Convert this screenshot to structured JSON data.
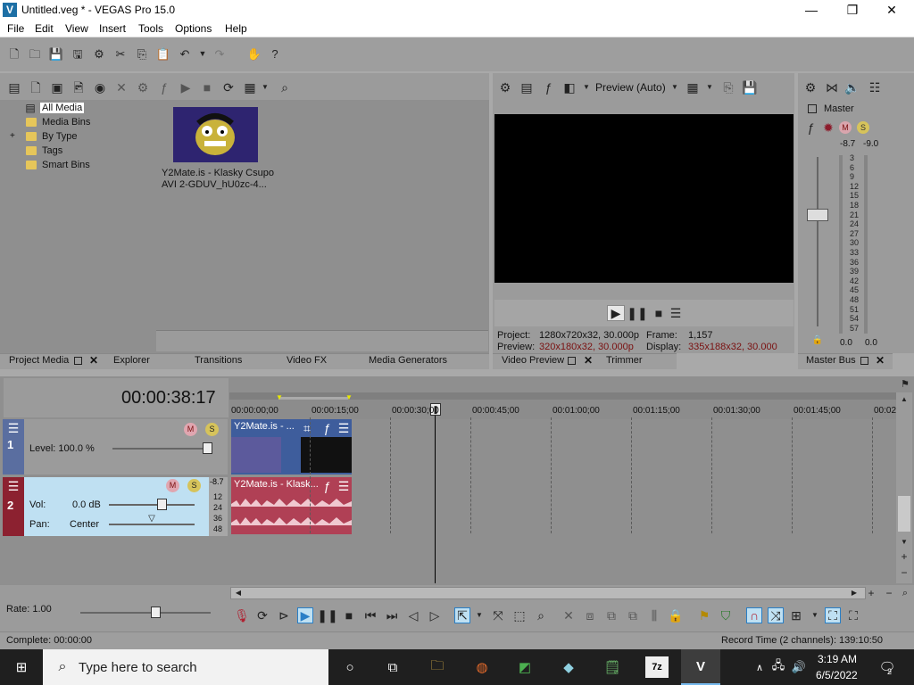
{
  "window": {
    "title": "Untitled.veg * - VEGAS Pro 15.0",
    "logo": "V",
    "minimize": "—",
    "maximize": "❐",
    "close": "✕"
  },
  "menu": [
    "File",
    "Edit",
    "View",
    "Insert",
    "Tools",
    "Options",
    "Help"
  ],
  "media": {
    "tree": [
      "All Media",
      "Media Bins",
      "By Type",
      "Tags",
      "Smart Bins"
    ],
    "expand": "+",
    "clip": {
      "caption_line1": "Y2Mate.is - Klasky Csupo",
      "caption_line2": "AVI 2-GDUV_hU0zc-4..."
    }
  },
  "tabs": {
    "project_media": "Project Media",
    "explorer": "Explorer",
    "transitions": "Transitions",
    "video_fx": "Video FX",
    "media_generators": "Media Generators",
    "video_preview": "Video Preview",
    "trimmer": "Trimmer",
    "master_bus": "Master Bus"
  },
  "preview": {
    "mode": "Preview (Auto)",
    "project_label": "Project:",
    "project_value": "1280x720x32, 30.000p",
    "frame_label": "Frame:",
    "frame_value": "1,157",
    "preview_label": "Preview:",
    "preview_value": "320x180x32, 30.000p",
    "display_label": "Display:",
    "display_value": "335x188x32, 30.000"
  },
  "master": {
    "label": "Master",
    "peak_left": "-8.7",
    "peak_right": "-9.0",
    "scale": [
      "3",
      "6",
      "9",
      "12",
      "15",
      "18",
      "21",
      "24",
      "27",
      "30",
      "33",
      "36",
      "39",
      "42",
      "45",
      "48",
      "51",
      "54",
      "57"
    ],
    "bottom_left": "0.0",
    "bottom_right": "0.0"
  },
  "timeline": {
    "timecode": "00:00:38:17",
    "ruler": [
      "00:00:00;00",
      "00:00:15;00",
      "00:00:30;00",
      "00:00:45;00",
      "00:01:00;00",
      "00:01:15;00",
      "00:01:30;00",
      "00:01:45;00",
      "00:02"
    ],
    "track1": {
      "number": "1",
      "level": "Level: 100.0 %",
      "event_title": "Y2Mate.is - ..."
    },
    "track2": {
      "number": "2",
      "vol_label": "Vol:",
      "vol_value": "0.0 dB",
      "pan_label": "Pan:",
      "pan_value": "Center",
      "meter_peak": "-8.7",
      "meter_scale": [
        "12",
        "24",
        "36",
        "48"
      ],
      "event_title": "Y2Mate.is - Klask..."
    }
  },
  "transport": {
    "rate": "Rate: 1.00"
  },
  "status": {
    "left": "Complete: 00:00:00",
    "right": "Record Time (2 channels): 139:10:50"
  },
  "taskbar": {
    "search_placeholder": "Type here to search",
    "time": "3:19 AM",
    "date": "6/5/2022",
    "notifications": "2"
  }
}
